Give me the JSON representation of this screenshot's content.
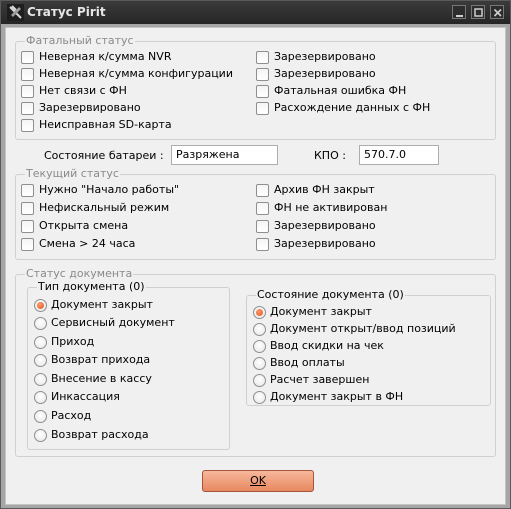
{
  "window": {
    "title": "Статус Pirit"
  },
  "fatal": {
    "title": "Фатальный статус",
    "left": [
      "Неверная к/сумма NVR",
      "Неверная к/сумма конфигурации",
      "Нет связи с ФН",
      "Зарезервировано",
      "Неисправная SD-карта"
    ],
    "right": [
      "Зарезервировано",
      "Зарезервировано",
      "Фатальная ошибка ФН",
      "Расхождение данных с ФН"
    ]
  },
  "battery": {
    "label": "Состояние батареи :",
    "value": "Разряжена"
  },
  "kpo": {
    "label": "КПО :",
    "value": "570.7.0"
  },
  "current": {
    "title": "Текущий статус",
    "left": [
      "Нужно \"Начало работы\"",
      "Нефискальный режим",
      "Открыта смена",
      "Смена > 24 часа"
    ],
    "right": [
      "Архив ФН закрыт",
      "ФН не активирован",
      "Зарезервировано",
      "Зарезервировано"
    ]
  },
  "document": {
    "title": "Статус документа",
    "type": {
      "title": "Тип документа (0)",
      "selected": 0,
      "options": [
        "Документ закрыт",
        "Сервисный документ",
        "Приход",
        "Возврат прихода",
        "Внесение в кассу",
        "Инкассация",
        "Расход",
        "Возврат расхода"
      ]
    },
    "state": {
      "title": "Состояние документа (0)",
      "selected": 0,
      "options": [
        "Документ закрыт",
        "Документ открыт/ввод позиций",
        "Ввод скидки на чек",
        "Ввод оплаты",
        "Расчет завершен",
        "Документ закрыт в ФН"
      ]
    }
  },
  "ok_label": "OK",
  "colors": {
    "accent": "#e7895f",
    "radio_selected": "#e0531e",
    "titlebar": "#2b2b2b"
  }
}
